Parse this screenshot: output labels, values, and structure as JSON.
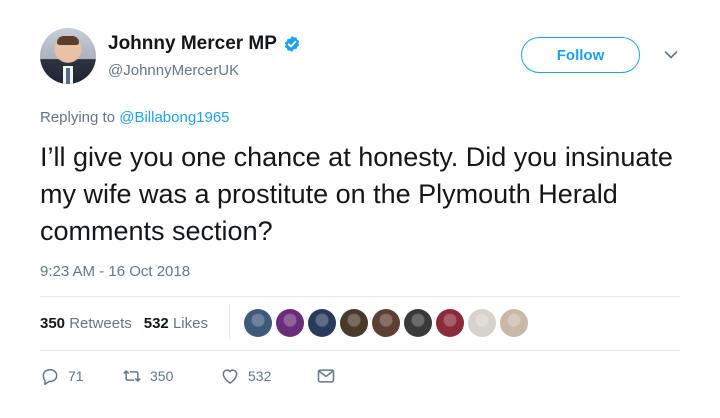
{
  "user": {
    "name": "Johnny Mercer MP",
    "handle": "@JohnnyMercerUK",
    "verified_color": "#1da1f2"
  },
  "follow_label": "Follow",
  "reply": {
    "prefix": "Replying to",
    "mention": "@Billabong1965"
  },
  "tweet": {
    "text": "I’ll give you one chance at honesty. Did you insinuate my wife was a prostitute on the Plymouth Herald comments section?",
    "timestamp": "9:23 AM - 16 Oct 2018"
  },
  "stats": {
    "retweets_count": "350",
    "retweets_label": "Retweets",
    "likes_count": "532",
    "likes_label": "Likes"
  },
  "likers": [
    {
      "name": "liker-avatar-1",
      "color": "#3d5a7a"
    },
    {
      "name": "liker-avatar-ukip",
      "color": "#6b2c7a"
    },
    {
      "name": "liker-avatar-3",
      "color": "#2a3a5c"
    },
    {
      "name": "liker-avatar-4",
      "color": "#4a3a2a"
    },
    {
      "name": "liker-avatar-5",
      "color": "#5c4033"
    },
    {
      "name": "liker-avatar-6",
      "color": "#3a3a3a"
    },
    {
      "name": "liker-avatar-7",
      "color": "#8a2a3a"
    },
    {
      "name": "liker-avatar-8",
      "color": "#d8d2cc"
    },
    {
      "name": "liker-avatar-9",
      "color": "#c9b8a8"
    }
  ],
  "actions": {
    "replies": "71",
    "retweets": "350",
    "likes": "532"
  },
  "colors": {
    "accent": "#1da1f2",
    "text": "#14171a",
    "secondary": "#657786",
    "border": "#e6ecf0"
  }
}
